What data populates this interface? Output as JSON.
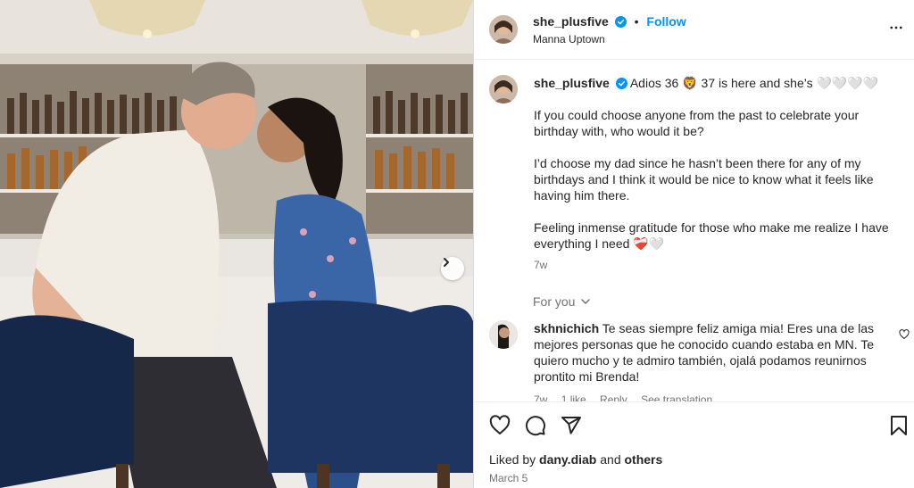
{
  "colors": {
    "accent": "#0095f6",
    "verified": "#0095f6",
    "muted": "#737373"
  },
  "post": {
    "username": "she_plusfive",
    "follow_label": "Follow",
    "location": "Manna Uptown"
  },
  "caption": {
    "username": "she_plusfive",
    "line1": "Adios 36 🦁 37 is here and she’s 🤍🤍🤍🤍",
    "para1": "If you could choose anyone from the past to celebrate your birthday with, who would it be?",
    "para2": "I’d choose my dad since he hasn’t been there for any of my birthdays and I think it would be nice to know what it feels like having him there.",
    "para3": "Feeling inmense gratitude for those who make me realize I have everything I need ❤️‍🩹🤍",
    "age": "7w"
  },
  "for_you_label": "For you",
  "comment": {
    "username": "skhnichich",
    "text": "Te seas siempre feliz amiga mia! Eres una de las mejores personas que he conocido cuando estaba en MN. Te quiero mucho y te admiro también, ojalá podamos reunirnos prontito mi Brenda!",
    "age": "7w",
    "likes": "1 like",
    "reply": "Reply",
    "translation": "See translation"
  },
  "likes": {
    "prefix": "Liked by",
    "user": "dany.diab",
    "and": "and",
    "others": "others"
  },
  "date": "March 5",
  "icons": [
    "heart-icon",
    "comment-icon",
    "share-icon",
    "bookmark-icon",
    "more-icon",
    "verified-icon",
    "chevron-right-icon",
    "chevron-down-icon"
  ]
}
